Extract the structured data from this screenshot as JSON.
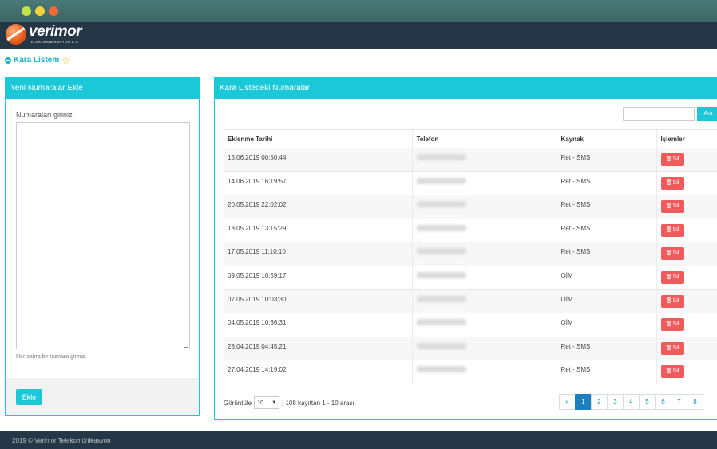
{
  "brand": {
    "name": "verimor",
    "tagline": "TELEKOMÜNİKASYON A.Ş."
  },
  "page": {
    "title": "Kara Listem"
  },
  "left_panel": {
    "title": "Yeni Numaralar Ekle",
    "input_label": "Numaraları giriniz:",
    "hint": "Her satıra bir numara giriniz.",
    "add_button": "Ekle"
  },
  "right_panel": {
    "title": "Kara Listedeki Numaralar",
    "search_button": "Ara",
    "columns": [
      "Eklenme Tarihi",
      "Telefon",
      "Kaynak",
      "İşlemler"
    ],
    "delete_label": "Sil",
    "rows": [
      {
        "date": "15.06.2019 00:50:44",
        "source": "Ret - SMS"
      },
      {
        "date": "14.06.2019 16:19:57",
        "source": "Ret - SMS"
      },
      {
        "date": "20.05.2019 22:02:02",
        "source": "Ret - SMS"
      },
      {
        "date": "18.05.2019 13:15:29",
        "source": "Ret - SMS"
      },
      {
        "date": "17.05.2019 11:10:10",
        "source": "Ret - SMS"
      },
      {
        "date": "09.05.2019 10:59:17",
        "source": "OİM"
      },
      {
        "date": "07.05.2019 10:03:30",
        "source": "OİM"
      },
      {
        "date": "04.05.2019 10:36:31",
        "source": "OİM"
      },
      {
        "date": "28.04.2019 04:45:21",
        "source": "Ret - SMS"
      },
      {
        "date": "27.04.2019 14:19:02",
        "source": "Ret - SMS"
      }
    ],
    "pager": {
      "show_label": "Görüntüle",
      "page_size": "10",
      "summary": "| 108 kayıttan 1 - 10 arası.",
      "prev": "«",
      "pages": [
        "1",
        "2",
        "3",
        "4",
        "5",
        "6",
        "7",
        "8"
      ],
      "active_page": "1"
    }
  },
  "footer": {
    "text": "2019 © Verimor Telekomünikasyon"
  },
  "colors": {
    "accent": "#1bc8d8",
    "navbar": "#253746",
    "danger": "#ef5a5a",
    "pager_active": "#1b7fc0"
  }
}
